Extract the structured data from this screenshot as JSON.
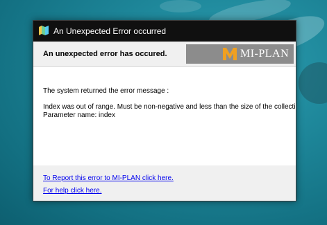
{
  "window": {
    "title": "An Unexpected Error occurred",
    "app_icon": "map-icon"
  },
  "header": {
    "heading": "An unexpected error has occured.",
    "logo_text": "MI-PLAN",
    "logo_mark": "m-logo-icon",
    "logo_accent_color": "#f0a020"
  },
  "body": {
    "intro": "The system returned the error message :",
    "message_line1": "Index was out of range. Must be non-negative and less than the size of the collection.",
    "message_line2": "Parameter name: index"
  },
  "footer": {
    "report_link": "To Report this error to MI-PLAN click here.",
    "help_link": "For help click here."
  },
  "colors": {
    "titlebar": "#101010",
    "header_bg": "#f0f0f0",
    "logo_bg": "#8c8c8c",
    "link": "#0000ee",
    "desktop": "#1d8598"
  }
}
